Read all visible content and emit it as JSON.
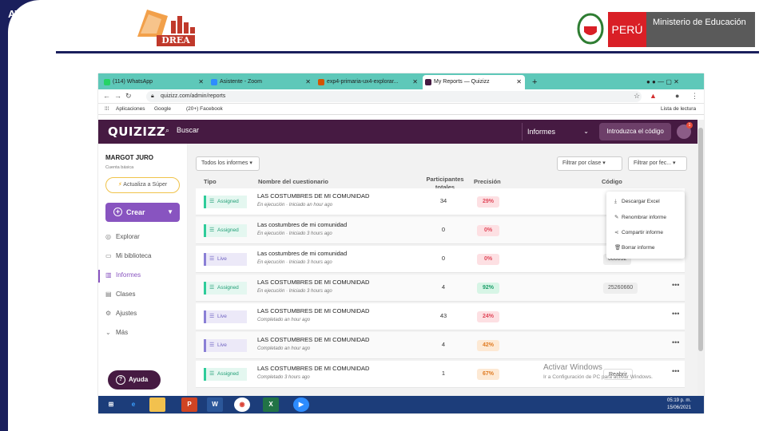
{
  "slide": {
    "title": "ATAT",
    "drea_label": "DREA",
    "peru_label": "PERÚ",
    "ministry": "Ministerio de Educación"
  },
  "browser": {
    "tabs": [
      {
        "label": "(114) WhatsApp",
        "icon": "whatsapp-icon",
        "color": "#25d366"
      },
      {
        "label": "Asistente - Zoom",
        "icon": "zoom-icon",
        "color": "#2d8cff"
      },
      {
        "label": "exp4-primaria-ux4-explorar...",
        "icon": "doc-icon",
        "color": "#d35400"
      },
      {
        "label": "My Reports — Quizizz",
        "icon": "quizizz-icon",
        "color": "#461a42"
      }
    ],
    "url": "quizizz.com/admin/reports",
    "bookmarks": [
      "Aplicaciones",
      "Google",
      "(20+) Facebook"
    ],
    "reading_list": "Lista de lectura"
  },
  "quizizz": {
    "logo": "QUIZIZZ",
    "search_placeholder": "Buscar",
    "reports_menu": "Informes",
    "code_button": "Introduzca el código",
    "notification_count": "1",
    "user_name": "MARGOT JURO",
    "account_type": "Cuenta básica",
    "upgrade_label": "Actualiza a Súper",
    "create_label": "Crear",
    "nav": [
      {
        "label": "Explorar",
        "icon": "compass-icon",
        "glyph": "◎"
      },
      {
        "label": "Mi biblioteca",
        "icon": "folder-icon",
        "glyph": "▭"
      },
      {
        "label": "Informes",
        "icon": "chart-icon",
        "glyph": "▥"
      },
      {
        "label": "Clases",
        "icon": "class-icon",
        "glyph": "▤"
      },
      {
        "label": "Ajustes",
        "icon": "gear-icon",
        "glyph": "⚙"
      },
      {
        "label": "Más",
        "icon": "chevron-down-icon",
        "glyph": "⌄"
      }
    ],
    "help_label": "Ayuda",
    "filters": {
      "all_reports": "Todos los informes",
      "class_filter": "Filtrar por clase",
      "date_filter": "Filtrar por fec..."
    },
    "columns": {
      "type": "Tipo",
      "name": "Nombre del cuestionario",
      "participants": "Participantes totales",
      "accuracy": "Precisión",
      "code": "Código"
    },
    "rows": [
      {
        "type": "Assigned",
        "title": "LAS COSTUMBRES DE MI COMUNIDAD",
        "sub": "En ejecución · Iniciado an hour ago",
        "participants": "34",
        "accuracy": "29%",
        "code": ""
      },
      {
        "type": "Assigned",
        "title": "Las costumbres de mi comunidad",
        "sub": "En ejecución · Iniciado 3 hours ago",
        "participants": "0",
        "accuracy": "0%",
        "code": ""
      },
      {
        "type": "Live",
        "title": "Las costumbres de mi comunidad",
        "sub": "En ejecución · Iniciado 3 hours ago",
        "participants": "0",
        "accuracy": "0%",
        "code": "080832"
      },
      {
        "type": "Assigned",
        "title": "LAS COSTUMBRES DE MI COMUNIDAD",
        "sub": "En ejecución · Iniciado 3 hours ago",
        "participants": "4",
        "accuracy": "92%",
        "code": "25260660"
      },
      {
        "type": "Live",
        "title": "LAS COSTUMBRES DE MI COMUNIDAD",
        "sub": "Completado an hour ago",
        "participants": "43",
        "accuracy": "24%",
        "code": ""
      },
      {
        "type": "Live",
        "title": "LAS COSTUMBRES DE MI COMUNIDAD",
        "sub": "Completado an hour ago",
        "participants": "4",
        "accuracy": "42%",
        "code": ""
      },
      {
        "type": "Assigned",
        "title": "LAS COSTUMBRES DE MI COMUNIDAD",
        "sub": "Completado 3 hours ago",
        "participants": "1",
        "accuracy": "67%",
        "code": "Reabrir"
      }
    ],
    "context_menu": [
      "Descargar Excel",
      "Renombrar informe",
      "Compartir informe",
      "Borrar informe"
    ],
    "watermark_title": "Activar Windows",
    "watermark_sub": "Ir a Configuración de PC para activar Windows."
  },
  "taskbar": {
    "apps": [
      "Windows",
      "Edge",
      "Explorer",
      "PowerPoint",
      "Word",
      "Chrome",
      "Excel",
      "Zoom"
    ],
    "time": "05:19 p. m.",
    "date": "15/06/2021"
  }
}
